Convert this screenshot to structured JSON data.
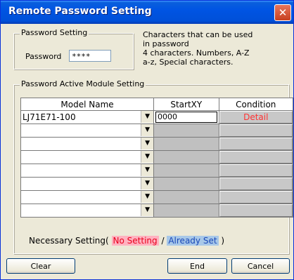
{
  "window": {
    "title": "Remote Password Setting",
    "close_glyph": "✕"
  },
  "password_group": {
    "legend": "Password Setting",
    "label": "Password",
    "value": "****",
    "hint_lines": [
      "Characters that can be used",
      "in password",
      " 4 characters. Numbers, A-Z",
      "a-z, Special characters."
    ]
  },
  "module_group": {
    "legend": "Password Active Module Setting",
    "columns": {
      "model": "Model Name",
      "start": "StartXY",
      "condition": "Condition"
    },
    "rows": [
      {
        "model": "LJ71E71-100",
        "start": "0000",
        "condition": "Detail"
      },
      {
        "model": "",
        "start": "",
        "condition": ""
      },
      {
        "model": "",
        "start": "",
        "condition": ""
      },
      {
        "model": "",
        "start": "",
        "condition": ""
      },
      {
        "model": "",
        "start": "",
        "condition": ""
      },
      {
        "model": "",
        "start": "",
        "condition": ""
      },
      {
        "model": "",
        "start": "",
        "condition": ""
      },
      {
        "model": "",
        "start": "",
        "condition": ""
      }
    ],
    "dropdown_glyph": "▼"
  },
  "necessary_setting": {
    "prefix": "Necessary Setting(",
    "no_setting": "No Setting",
    "separator": "/",
    "already_set": "Already Set",
    "suffix": ")"
  },
  "buttons": {
    "clear": "Clear",
    "end": "End",
    "cancel": "Cancel"
  },
  "colors": {
    "title_bar": "#0054e3",
    "no_setting_bg": "#ffb2c0",
    "already_set_bg": "#a8c8e8",
    "detail_text": "#ff3333"
  }
}
